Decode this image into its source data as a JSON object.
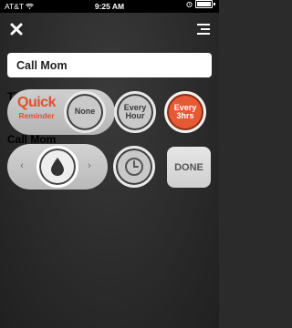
{
  "status_bar": {
    "carrier": "AT&T",
    "time": "9:25 AM"
  },
  "nav": {
    "close_icon": "close-icon",
    "menu_icon": "hamburger-icon"
  },
  "reminder": {
    "title_value": "Call Mom",
    "ghost_label_top": "Ti",
    "ghost_label": "Call Mom"
  },
  "quick_reminder": {
    "line1": "Quick",
    "line2": "Reminder",
    "options": [
      {
        "line1": "None",
        "line2": ""
      },
      {
        "line1": "Every",
        "line2": "Hour"
      },
      {
        "line1": "Every",
        "line2": "3hrs"
      }
    ],
    "selected_index": 2
  },
  "controls": {
    "left_arrow": "‹",
    "right_arrow": "›",
    "drop_icon": "water-drop-icon",
    "clock_icon": "clock-icon",
    "done_label": "DONE"
  },
  "colors": {
    "accent": "#e55a34",
    "background": "#2b2b2b"
  }
}
